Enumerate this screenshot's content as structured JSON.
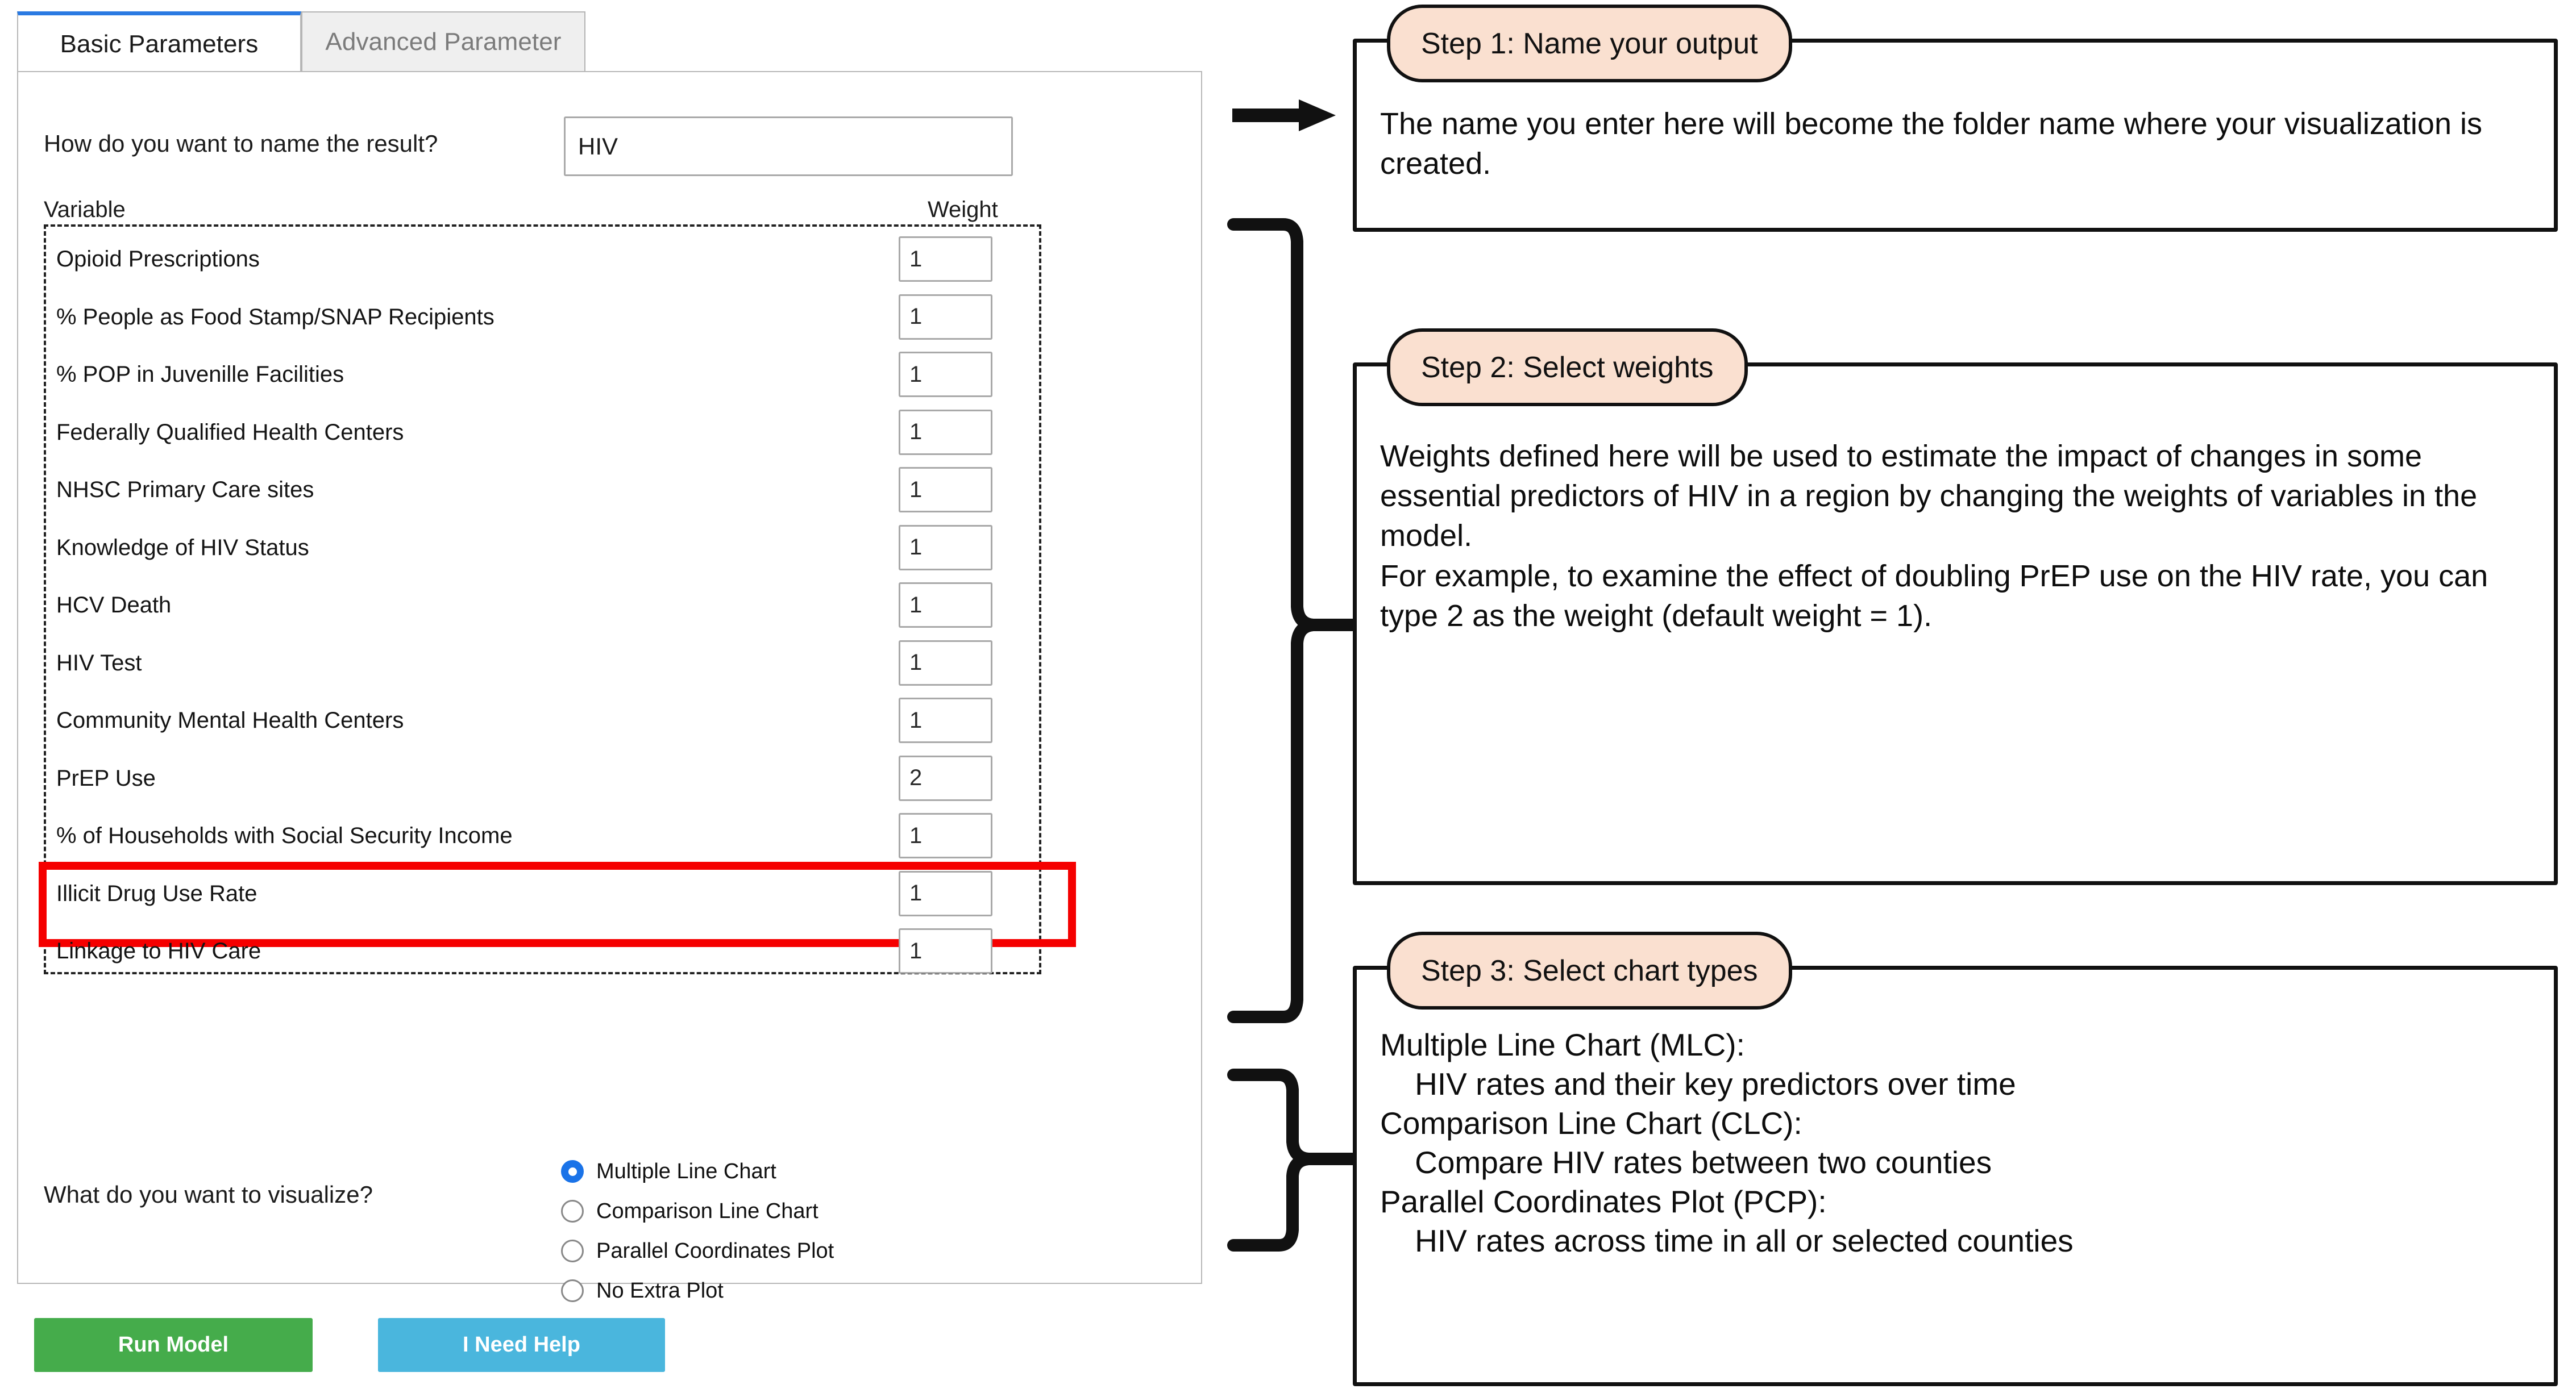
{
  "tabs": [
    {
      "label": "Basic Parameters",
      "active": true
    },
    {
      "label": "Advanced Parameter",
      "active": false
    }
  ],
  "form": {
    "name_label": "How do you want to name the result?",
    "name_value": "HIV",
    "name_placeholder": "",
    "column_headers": {
      "variable": "Variable",
      "weight": "Weight"
    },
    "variables": [
      {
        "label": "Opioid Prescriptions",
        "weight": "1",
        "highlighted": false
      },
      {
        "label": "% People as Food Stamp/SNAP Recipients",
        "weight": "1",
        "highlighted": false
      },
      {
        "label": "% POP in Juvenille Facilities",
        "weight": "1",
        "highlighted": false
      },
      {
        "label": "Federally Qualified Health Centers",
        "weight": "1",
        "highlighted": false
      },
      {
        "label": "NHSC Primary Care sites",
        "weight": "1",
        "highlighted": false
      },
      {
        "label": "Knowledge of HIV Status",
        "weight": "1",
        "highlighted": false
      },
      {
        "label": "HCV Death",
        "weight": "1",
        "highlighted": false
      },
      {
        "label": "HIV Test",
        "weight": "1",
        "highlighted": false
      },
      {
        "label": "Community Mental Health Centers",
        "weight": "1",
        "highlighted": false
      },
      {
        "label": "PrEP Use",
        "weight": "2",
        "highlighted": true
      },
      {
        "label": "% of Households with Social Security Income",
        "weight": "1",
        "highlighted": false
      },
      {
        "label": "Illicit Drug Use Rate",
        "weight": "1",
        "highlighted": false
      },
      {
        "label": "Linkage to HIV Care",
        "weight": "1",
        "highlighted": false
      }
    ],
    "visualize_label": "What do you want to visualize?",
    "visualize_options": [
      {
        "label": "Multiple Line Chart",
        "selected": true
      },
      {
        "label": "Comparison Line Chart",
        "selected": false
      },
      {
        "label": "Parallel Coordinates Plot",
        "selected": false
      },
      {
        "label": "No Extra Plot",
        "selected": false
      }
    ]
  },
  "buttons": {
    "run_model": "Run Model",
    "help": "I Need Help"
  },
  "callouts": [
    {
      "title": "Step 1: Name your output",
      "body": "The name you enter here will become the folder name where your visualization is created."
    },
    {
      "title": "Step 2: Select weights",
      "body": "Weights defined here will be used to estimate the impact of changes in some essential predictors of HIV in a region by changing the weights of variables in the model.\nFor example, to examine the effect of doubling PrEP use on the HIV rate, you can type 2 as the weight (default weight = 1)."
    },
    {
      "title": "Step 3: Select chart types",
      "body": "Multiple Line Chart (MLC):\n    HIV rates and their key predictors over time\nComparison Line Chart (CLC):\n    Compare HIV rates between two counties\nParallel Coordinates Plot (PCP):\n    HIV rates across time in all or selected counties"
    }
  ],
  "colors": {
    "highlight": "#f50000",
    "accent_tab": "#2a7ae2",
    "run_button": "#45ac4b",
    "help_button": "#4ab6dd",
    "callout_title_bg": "#fae0d0",
    "radio_selected": "#1a73e8"
  }
}
